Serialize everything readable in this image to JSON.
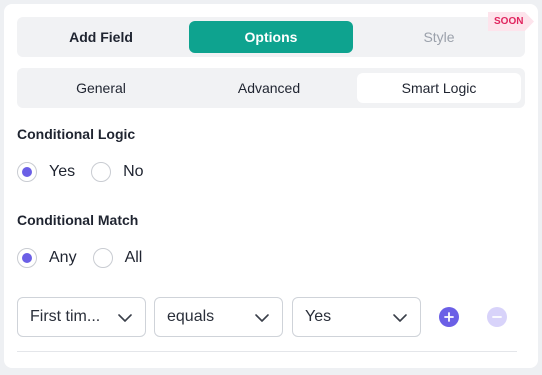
{
  "tabs": {
    "main": [
      "Add Field",
      "Options",
      "Style"
    ],
    "badge": "SOON",
    "sub": [
      "General",
      "Advanced",
      "Smart Logic"
    ]
  },
  "conditional_logic": {
    "label": "Conditional Logic",
    "options": [
      "Yes",
      "No"
    ],
    "selected": "Yes"
  },
  "conditional_match": {
    "label": "Conditional Match",
    "options": [
      "Any",
      "All"
    ],
    "selected": "Any"
  },
  "rule": {
    "field": "First tim...",
    "operator": "equals",
    "value": "Yes"
  },
  "colors": {
    "accent": "#0ea38f",
    "radio": "#6b5fe6",
    "badge": "#e0245e"
  },
  "icons": [
    "chevron-down-icon",
    "plus-icon",
    "minus-icon"
  ]
}
